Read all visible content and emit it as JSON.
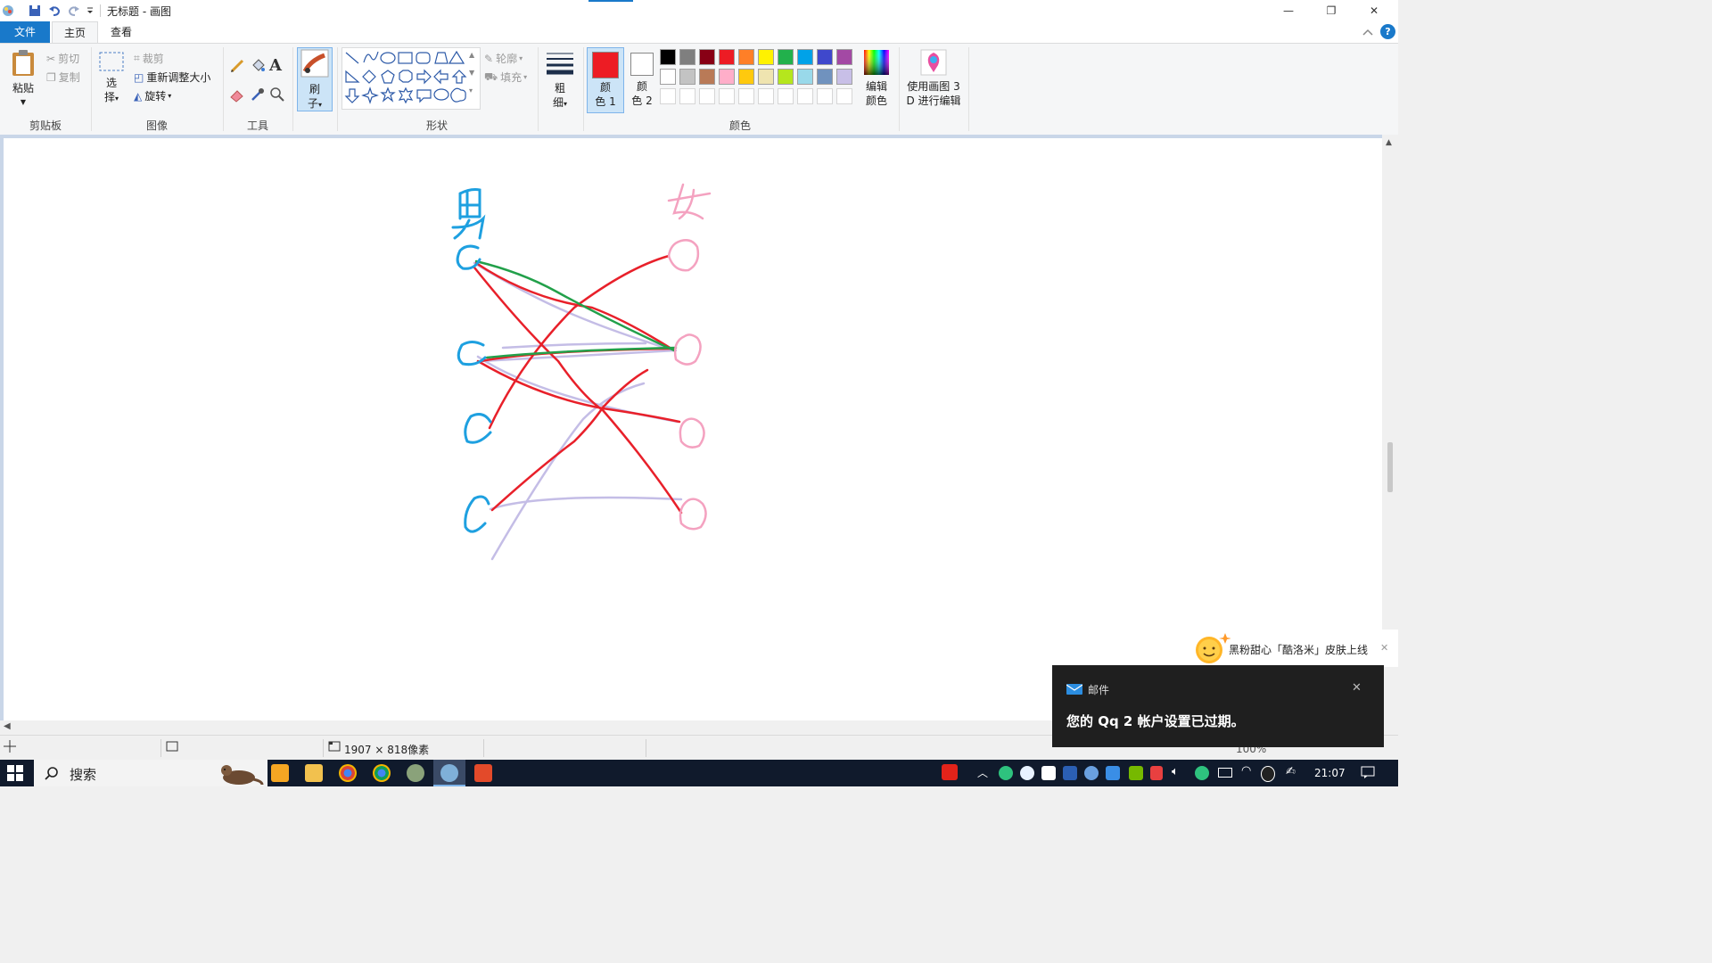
{
  "window": {
    "title": "无标题 - 画图",
    "minimize_label": "—",
    "restore_label": "❐",
    "close_label": "✕"
  },
  "tabs": [
    "文件",
    "主页",
    "查看"
  ],
  "clipboard": {
    "paste": "粘贴",
    "cut": "剪切",
    "copy": "复制",
    "group": "剪贴板"
  },
  "image": {
    "select": "选",
    "select2": "择",
    "crop": "裁剪",
    "resize": "重新调整大小",
    "rotate": "旋转",
    "group": "图像"
  },
  "tools": {
    "group": "工具",
    "text_tool": "A"
  },
  "brushes": {
    "label1": "刷",
    "label2": "子"
  },
  "shapes": {
    "outline": "轮廓",
    "fill": "填充",
    "group": "形状"
  },
  "size": {
    "label1": "粗",
    "label2": "细"
  },
  "colors": {
    "color1_label1": "颜",
    "color1_label2": "色 1",
    "color2_label1": "颜",
    "color2_label2": "色 2",
    "edit1": "编辑",
    "edit2": "颜色",
    "group": "颜色",
    "color1": "#ed1c24",
    "color2": "#ffffff",
    "palette_row1": [
      "#000000",
      "#7f7f7f",
      "#880015",
      "#ed1c24",
      "#ff7f27",
      "#fff200",
      "#22b14c",
      "#00a2e8",
      "#3f48cc",
      "#a349a4"
    ],
    "palette_row2": [
      "#ffffff",
      "#c3c3c3",
      "#b97a57",
      "#ffaec9",
      "#ffc90e",
      "#efe4b0",
      "#b5e61d",
      "#99d9ea",
      "#7092be",
      "#c8bfe7"
    ]
  },
  "paint3d": {
    "label1": "使用画图 3",
    "label2": "D 进行编辑"
  },
  "drawing": {
    "male_char": "男",
    "female_char": "女",
    "male_color": "#1ea0e0",
    "female_color": "#f4a2c0",
    "red_line": "#e8202a",
    "green_line": "#22a04a",
    "lavender_line": "#c4bde6"
  },
  "status": {
    "dimensions": "1907 × 818像素",
    "zoom": "100%"
  },
  "notifications": {
    "qq_text": "黑粉甜心「酷洛米」皮肤上线",
    "mail_app": "邮件",
    "mail_message": "您的 Qq 2 帐户设置已过期。",
    "close": "✕"
  },
  "taskbar": {
    "search": "搜索",
    "time": "21:07"
  }
}
